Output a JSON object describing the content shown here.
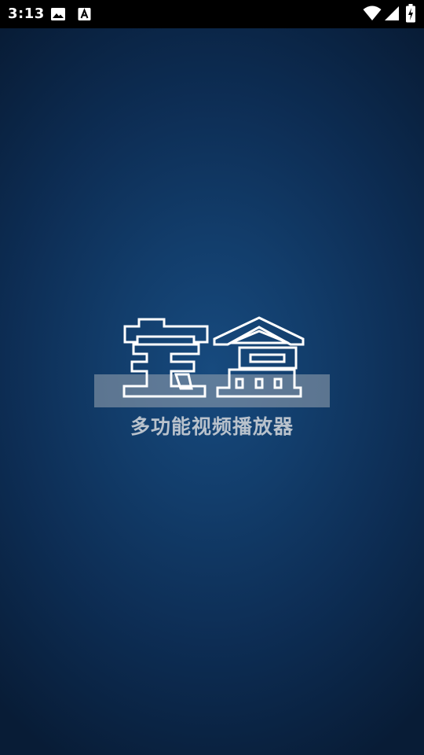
{
  "status_bar": {
    "time": "3:13",
    "icons": [
      "image-icon",
      "font-a-icon",
      "wifi-icon",
      "cellular-signal-icon",
      "battery-charging-icon"
    ]
  },
  "splash": {
    "logo_text": "宝盒",
    "tagline": "多功能视频播放器",
    "colors": {
      "background_center": "#174a7e",
      "background_edge": "#081c36",
      "logo_outline": "#ffffff",
      "logo_band": "#9aa6b3",
      "tagline": "#b9c2cc"
    }
  }
}
